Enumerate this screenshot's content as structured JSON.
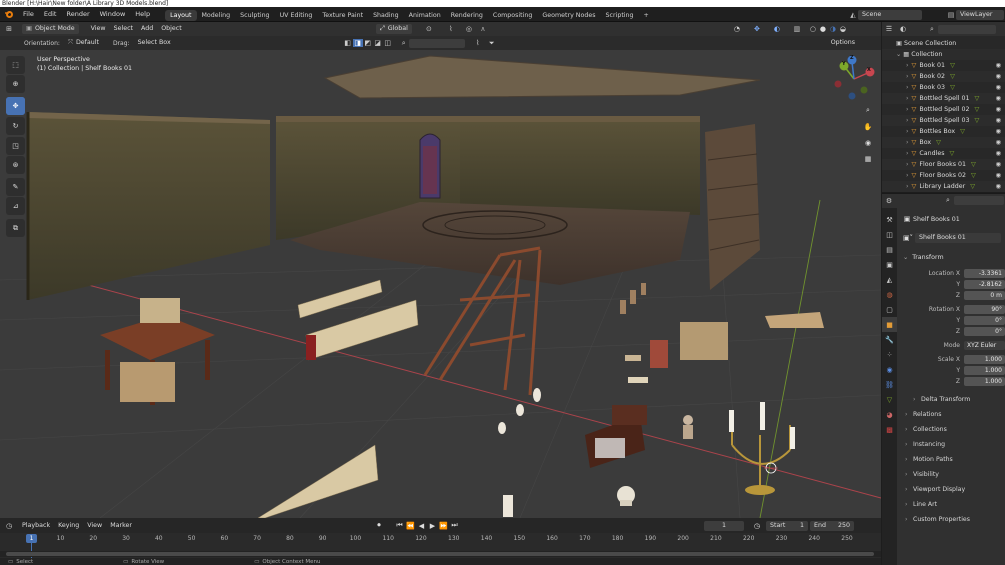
{
  "titlebar": {
    "title": "Blender  [H:\\Hair\\New folder\\A Library 3D Models.blend]"
  },
  "menu": [
    "File",
    "Edit",
    "Render",
    "Window",
    "Help"
  ],
  "workspaces": [
    "Layout",
    "Modeling",
    "Sculpting",
    "UV Editing",
    "Texture Paint",
    "Shading",
    "Animation",
    "Rendering",
    "Compositing",
    "Geometry Nodes",
    "Scripting"
  ],
  "active_workspace": "Layout",
  "add_workspace": "+",
  "scene": {
    "label": "Scene",
    "view_layer": "ViewLayer"
  },
  "viewport_header": {
    "mode": "Object Mode",
    "menus": [
      "View",
      "Select",
      "Add",
      "Object"
    ],
    "transform_orientation": "Global",
    "orientation_label": "Orientation:",
    "orientation_value": "Default",
    "drag_label": "Drag:",
    "drag_value": "Select Box",
    "options": "Options"
  },
  "viewport_info": {
    "line1": "User Perspective",
    "line2": "(1) Collection | Shelf Books 01"
  },
  "gizmo": {
    "x": "X",
    "y": "Y",
    "z": "Z"
  },
  "outliner": {
    "root": "Scene Collection",
    "collection": "Collection",
    "items": [
      "Book 01",
      "Book 02",
      "Book 03",
      "Bottled Spell 01",
      "Bottled Spell 02",
      "Bottled Spell 03",
      "Bottles Box",
      "Box",
      "Candles",
      "Floor Books 01",
      "Floor Books 02",
      "Library Ladder"
    ]
  },
  "properties": {
    "object_name": "Shelf Books 01",
    "object_selector": "Shelf Books 01",
    "transform_title": "Transform",
    "location": {
      "label": "Location X",
      "x": "-3.3361",
      "y": "-2.8162",
      "z": "0 m"
    },
    "rotation": {
      "label": "Rotation X",
      "x": "90°",
      "y": "0°",
      "z": "0°"
    },
    "mode": {
      "label": "Mode",
      "value": "XYZ Euler"
    },
    "scale": {
      "label": "Scale X",
      "x": "1.000",
      "y": "1.000",
      "z": "1.000"
    },
    "axis_y": "Y",
    "axis_z": "Z",
    "delta": "Delta Transform",
    "panels": [
      "Relations",
      "Collections",
      "Instancing",
      "Motion Paths",
      "Visibility",
      "Viewport Display",
      "Line Art",
      "Custom Properties"
    ]
  },
  "timeline": {
    "menus": [
      "Playback",
      "Keying",
      "View",
      "Marker"
    ],
    "current_frame": "1",
    "start_label": "Start",
    "start": "1",
    "end_label": "End",
    "end": "250",
    "ticks": [
      "1",
      "10",
      "20",
      "30",
      "40",
      "50",
      "60",
      "70",
      "80",
      "90",
      "100",
      "110",
      "120",
      "130",
      "140",
      "150",
      "160",
      "170",
      "180",
      "190",
      "200",
      "210",
      "220",
      "230",
      "240",
      "250"
    ]
  },
  "statusbar": {
    "select": "Select",
    "rotate": "Rotate View",
    "context": "Object Context Menu"
  },
  "colors": {
    "accent": "#4772b3",
    "x_axis": "#c8464f",
    "y_axis": "#7ea92b",
    "z_axis": "#3f78c8",
    "mesh": "#e39c37"
  }
}
